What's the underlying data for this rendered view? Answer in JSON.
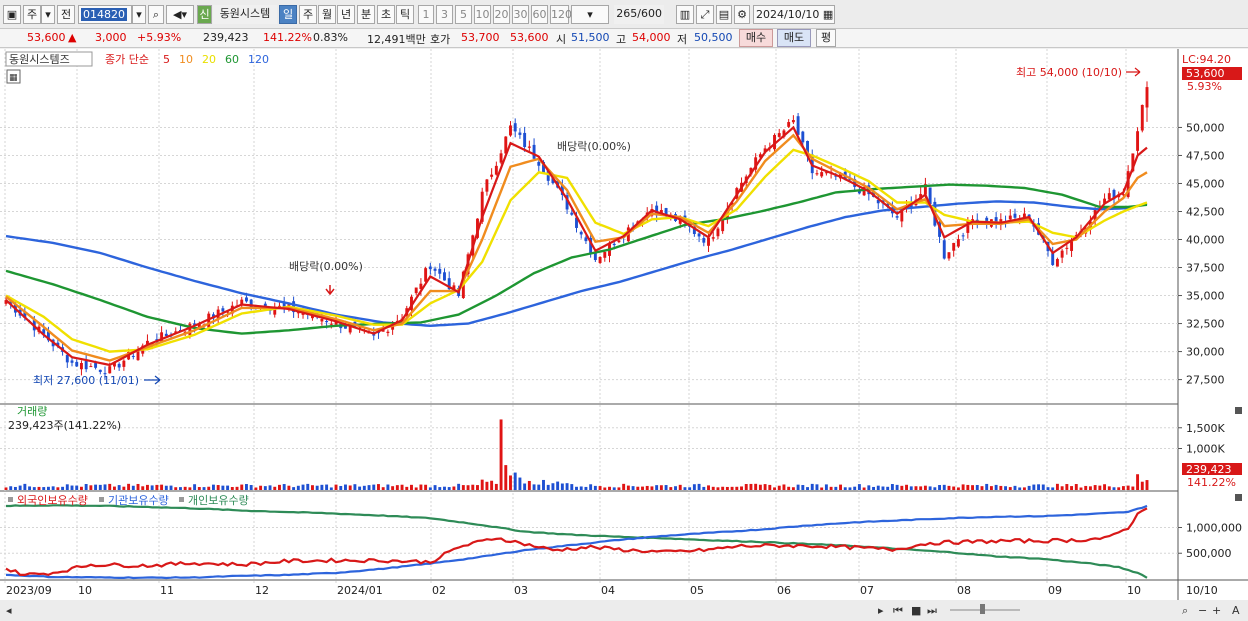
{
  "toolbar": {
    "type_label": "주",
    "prev_label": "전",
    "code": "014820",
    "shin_label": "신",
    "stock_name": "동원시스템",
    "periods": [
      "일",
      "주",
      "월",
      "년",
      "분",
      "초",
      "틱"
    ],
    "intervals": [
      "1",
      "3",
      "5",
      "10",
      "20",
      "30",
      "60",
      "120"
    ],
    "count": "265",
    "count_total": "/600",
    "date": "2024/10/10"
  },
  "info": {
    "price": "53,600",
    "arrow": "▲",
    "change": "3,000",
    "change_pct": "+5.93%",
    "volume": "239,423",
    "vol_ratio": "141.22%",
    "turnover": "0.83%",
    "amount": "12,491백만",
    "ask_label": "호가",
    "ask": "53,700",
    "bid": "53,600",
    "open_label": "시",
    "open": "51,500",
    "high_label": "고",
    "high": "54,000",
    "low_label": "저",
    "low": "50,500",
    "buy_label": "매수",
    "sell_label": "매도",
    "eval_label": "평"
  },
  "legend": {
    "name": "동원시스템즈",
    "ma_label": "종가 단순",
    "ma": [
      {
        "period": "5",
        "color": "#d81818"
      },
      {
        "period": "10",
        "color": "#f08c1e"
      },
      {
        "period": "20",
        "color": "#e8e000"
      },
      {
        "period": "60",
        "color": "#1e9632"
      },
      {
        "period": "120",
        "color": "#2d64dc"
      }
    ]
  },
  "annotations": {
    "lc": "LC:94.20",
    "last_price": "53,600",
    "last_pct": "5.93%",
    "high_note": "최고 54,000 (10/10)",
    "low_note": "최저 27,600 (11/01)",
    "div1": "배당락(0.00%)",
    "div2": "배당락(0.00%)"
  },
  "volume_panel": {
    "title": "거래량",
    "value_text": "239,423주(141.22%)",
    "last": "239,423",
    "last_pct": "141.22%"
  },
  "holdings_panel": {
    "series": [
      {
        "name": "외국인보유수량",
        "color": "#d81818"
      },
      {
        "name": "기관보유수량",
        "color": "#2d64dc"
      },
      {
        "name": "개인보유수량",
        "color": "#2e8b57"
      }
    ]
  },
  "chart_data": {
    "type": "candlestick",
    "price_axis": {
      "ticks": [
        "50,000",
        "47,500",
        "45,000",
        "42,500",
        "40,000",
        "37,500",
        "35,000",
        "32,500",
        "30,000",
        "27,500"
      ],
      "range": [
        25500,
        57000
      ]
    },
    "volume_axis": {
      "ticks": [
        "1,500K",
        "1,000K"
      ],
      "max": 2000000
    },
    "holdings_axis": {
      "ticks": [
        "1,000,000",
        "500,000"
      ],
      "range": [
        0,
        1650000
      ]
    },
    "x_labels": [
      "2023/09",
      "10",
      "11",
      "12",
      "2024/01",
      "02",
      "03",
      "04",
      "05",
      "06",
      "07",
      "08",
      "09",
      "10",
      "10/10"
    ],
    "close_anchors": [
      [
        0,
        34600
      ],
      [
        8,
        31500
      ],
      [
        14,
        29000
      ],
      [
        22,
        28300
      ],
      [
        30,
        30800
      ],
      [
        40,
        32400
      ],
      [
        50,
        34400
      ],
      [
        60,
        33800
      ],
      [
        70,
        32600
      ],
      [
        78,
        31200
      ],
      [
        84,
        33200
      ],
      [
        90,
        37800
      ],
      [
        96,
        35000
      ],
      [
        101,
        44000
      ],
      [
        107,
        50000
      ],
      [
        113,
        47000
      ],
      [
        119,
        43000
      ],
      [
        125,
        38300
      ],
      [
        131,
        40600
      ],
      [
        137,
        42800
      ],
      [
        143,
        41600
      ],
      [
        149,
        39800
      ],
      [
        155,
        44500
      ],
      [
        161,
        48200
      ],
      [
        167,
        50500
      ],
      [
        171,
        46000
      ],
      [
        177,
        45500
      ],
      [
        183,
        44000
      ],
      [
        189,
        42000
      ],
      [
        195,
        44500
      ],
      [
        199,
        38600
      ],
      [
        205,
        41800
      ],
      [
        211,
        41600
      ],
      [
        217,
        42100
      ],
      [
        222,
        38100
      ],
      [
        227,
        40400
      ],
      [
        233,
        43600
      ],
      [
        237,
        44300
      ],
      [
        240,
        50000
      ],
      [
        242,
        53600
      ]
    ],
    "ma_anchors": {
      "ma5": [
        [
          0,
          34600
        ],
        [
          8,
          31500
        ],
        [
          14,
          29500
        ],
        [
          22,
          28800
        ],
        [
          30,
          30600
        ],
        [
          40,
          32300
        ],
        [
          50,
          34200
        ],
        [
          60,
          33800
        ],
        [
          70,
          32700
        ],
        [
          78,
          31600
        ],
        [
          84,
          32800
        ],
        [
          90,
          36700
        ],
        [
          96,
          35300
        ],
        [
          101,
          42000
        ],
        [
          107,
          48600
        ],
        [
          113,
          47400
        ],
        [
          119,
          43600
        ],
        [
          125,
          39000
        ],
        [
          131,
          40300
        ],
        [
          137,
          42600
        ],
        [
          143,
          41800
        ],
        [
          149,
          40200
        ],
        [
          155,
          44000
        ],
        [
          161,
          47800
        ],
        [
          167,
          50000
        ],
        [
          171,
          46600
        ],
        [
          177,
          45600
        ],
        [
          183,
          44300
        ],
        [
          189,
          42300
        ],
        [
          195,
          44000
        ],
        [
          199,
          40200
        ],
        [
          205,
          41600
        ],
        [
          211,
          41500
        ],
        [
          217,
          42000
        ],
        [
          222,
          38800
        ],
        [
          227,
          40200
        ],
        [
          233,
          43200
        ],
        [
          237,
          44200
        ],
        [
          240,
          47500
        ],
        [
          242,
          48200
        ]
      ],
      "ma10": [
        [
          0,
          34900
        ],
        [
          8,
          32200
        ],
        [
          14,
          30100
        ],
        [
          22,
          29200
        ],
        [
          30,
          30400
        ],
        [
          40,
          31900
        ],
        [
          50,
          33900
        ],
        [
          60,
          33900
        ],
        [
          70,
          32900
        ],
        [
          78,
          31900
        ],
        [
          84,
          32500
        ],
        [
          90,
          35400
        ],
        [
          96,
          35400
        ],
        [
          101,
          40000
        ],
        [
          107,
          46500
        ],
        [
          113,
          47200
        ],
        [
          119,
          44400
        ],
        [
          125,
          39800
        ],
        [
          131,
          40200
        ],
        [
          137,
          42300
        ],
        [
          143,
          42000
        ],
        [
          149,
          40600
        ],
        [
          155,
          43400
        ],
        [
          161,
          47000
        ],
        [
          167,
          49300
        ],
        [
          171,
          47200
        ],
        [
          177,
          45900
        ],
        [
          183,
          44600
        ],
        [
          189,
          42700
        ],
        [
          195,
          43600
        ],
        [
          199,
          41200
        ],
        [
          205,
          41400
        ],
        [
          211,
          41400
        ],
        [
          217,
          41800
        ],
        [
          222,
          39600
        ],
        [
          227,
          40000
        ],
        [
          233,
          42500
        ],
        [
          237,
          43700
        ],
        [
          240,
          45500
        ],
        [
          242,
          46000
        ]
      ],
      "ma20": [
        [
          0,
          35000
        ],
        [
          8,
          33100
        ],
        [
          14,
          31100
        ],
        [
          22,
          30000
        ],
        [
          30,
          30200
        ],
        [
          40,
          31500
        ],
        [
          50,
          33400
        ],
        [
          60,
          34000
        ],
        [
          70,
          33200
        ],
        [
          78,
          32400
        ],
        [
          84,
          32400
        ],
        [
          90,
          34300
        ],
        [
          96,
          35500
        ],
        [
          101,
          38000
        ],
        [
          107,
          43500
        ],
        [
          113,
          46000
        ],
        [
          119,
          45500
        ],
        [
          125,
          41500
        ],
        [
          131,
          40500
        ],
        [
          137,
          41800
        ],
        [
          143,
          42000
        ],
        [
          149,
          41200
        ],
        [
          155,
          42700
        ],
        [
          161,
          45600
        ],
        [
          167,
          48000
        ],
        [
          171,
          47500
        ],
        [
          177,
          46400
        ],
        [
          183,
          45200
        ],
        [
          189,
          43300
        ],
        [
          195,
          43300
        ],
        [
          199,
          42200
        ],
        [
          205,
          41600
        ],
        [
          211,
          41500
        ],
        [
          217,
          41600
        ],
        [
          222,
          40600
        ],
        [
          227,
          40200
        ],
        [
          233,
          41700
        ],
        [
          237,
          42500
        ],
        [
          240,
          43000
        ],
        [
          242,
          43300
        ]
      ],
      "ma60": [
        [
          0,
          37200
        ],
        [
          10,
          36000
        ],
        [
          20,
          34600
        ],
        [
          30,
          33100
        ],
        [
          40,
          32100
        ],
        [
          50,
          31600
        ],
        [
          60,
          31900
        ],
        [
          70,
          32300
        ],
        [
          80,
          32500
        ],
        [
          88,
          32600
        ],
        [
          96,
          33300
        ],
        [
          104,
          35000
        ],
        [
          112,
          37000
        ],
        [
          120,
          38400
        ],
        [
          128,
          39100
        ],
        [
          136,
          40200
        ],
        [
          144,
          41300
        ],
        [
          152,
          41800
        ],
        [
          160,
          42500
        ],
        [
          168,
          43300
        ],
        [
          176,
          44200
        ],
        [
          184,
          44500
        ],
        [
          192,
          44700
        ],
        [
          200,
          44900
        ],
        [
          208,
          44800
        ],
        [
          216,
          44600
        ],
        [
          224,
          44000
        ],
        [
          232,
          42900
        ],
        [
          238,
          42900
        ],
        [
          242,
          43100
        ]
      ],
      "ma120": [
        [
          0,
          40300
        ],
        [
          10,
          39700
        ],
        [
          20,
          38800
        ],
        [
          30,
          37500
        ],
        [
          40,
          36300
        ],
        [
          50,
          35200
        ],
        [
          60,
          34300
        ],
        [
          70,
          33300
        ],
        [
          80,
          32600
        ],
        [
          90,
          32300
        ],
        [
          98,
          32500
        ],
        [
          106,
          33400
        ],
        [
          114,
          34400
        ],
        [
          122,
          35400
        ],
        [
          130,
          36200
        ],
        [
          138,
          37200
        ],
        [
          146,
          38200
        ],
        [
          154,
          39100
        ],
        [
          162,
          40100
        ],
        [
          170,
          41100
        ],
        [
          178,
          42000
        ],
        [
          186,
          42600
        ],
        [
          194,
          42900
        ],
        [
          202,
          43200
        ],
        [
          210,
          43400
        ],
        [
          218,
          43300
        ],
        [
          226,
          42900
        ],
        [
          232,
          42700
        ],
        [
          238,
          42800
        ],
        [
          242,
          43200
        ]
      ]
    },
    "volume_spikes": [
      [
        105,
        1700000
      ],
      [
        106,
        600000
      ],
      [
        107,
        350000
      ],
      [
        108,
        420000
      ],
      [
        109,
        300000
      ],
      [
        240,
        380000
      ],
      [
        241,
        200000
      ],
      [
        242,
        239423
      ]
    ],
    "holdings": {
      "foreign": [
        [
          0,
          200000
        ],
        [
          4,
          80000
        ],
        [
          10,
          120000
        ],
        [
          18,
          280000
        ],
        [
          30,
          260000
        ],
        [
          40,
          310000
        ],
        [
          50,
          280000
        ],
        [
          60,
          350000
        ],
        [
          70,
          360000
        ],
        [
          80,
          360000
        ],
        [
          90,
          330000
        ],
        [
          96,
          620000
        ],
        [
          104,
          800000
        ],
        [
          110,
          680000
        ],
        [
          116,
          560000
        ],
        [
          124,
          620000
        ],
        [
          132,
          560000
        ],
        [
          140,
          520000
        ],
        [
          148,
          560000
        ],
        [
          156,
          640000
        ],
        [
          164,
          650000
        ],
        [
          172,
          640000
        ],
        [
          180,
          610000
        ],
        [
          188,
          570000
        ],
        [
          196,
          700000
        ],
        [
          204,
          720000
        ],
        [
          212,
          740000
        ],
        [
          220,
          740000
        ],
        [
          228,
          760000
        ],
        [
          234,
          800000
        ],
        [
          238,
          1000000
        ],
        [
          240,
          1250000
        ],
        [
          242,
          1400000
        ]
      ],
      "institution": [
        [
          0,
          80000
        ],
        [
          10,
          40000
        ],
        [
          20,
          30000
        ],
        [
          30,
          25000
        ],
        [
          40,
          30000
        ],
        [
          50,
          60000
        ],
        [
          60,
          80000
        ],
        [
          70,
          120000
        ],
        [
          80,
          200000
        ],
        [
          90,
          300000
        ],
        [
          100,
          420000
        ],
        [
          110,
          560000
        ],
        [
          120,
          660000
        ],
        [
          130,
          760000
        ],
        [
          140,
          840000
        ],
        [
          150,
          900000
        ],
        [
          160,
          960000
        ],
        [
          170,
          1040000
        ],
        [
          180,
          1100000
        ],
        [
          190,
          1140000
        ],
        [
          200,
          1180000
        ],
        [
          210,
          1210000
        ],
        [
          220,
          1220000
        ],
        [
          230,
          1260000
        ],
        [
          238,
          1300000
        ],
        [
          242,
          1420000
        ]
      ],
      "individual": [
        [
          0,
          1420000
        ],
        [
          10,
          1430000
        ],
        [
          20,
          1420000
        ],
        [
          30,
          1400000
        ],
        [
          40,
          1370000
        ],
        [
          50,
          1330000
        ],
        [
          60,
          1300000
        ],
        [
          70,
          1270000
        ],
        [
          80,
          1230000
        ],
        [
          90,
          1180000
        ],
        [
          100,
          1060000
        ],
        [
          110,
          920000
        ],
        [
          120,
          860000
        ],
        [
          130,
          820000
        ],
        [
          140,
          790000
        ],
        [
          150,
          750000
        ],
        [
          160,
          720000
        ],
        [
          170,
          680000
        ],
        [
          180,
          640000
        ],
        [
          190,
          580000
        ],
        [
          200,
          520000
        ],
        [
          210,
          440000
        ],
        [
          220,
          390000
        ],
        [
          230,
          300000
        ],
        [
          236,
          230000
        ],
        [
          240,
          120000
        ],
        [
          242,
          30000
        ]
      ]
    }
  }
}
